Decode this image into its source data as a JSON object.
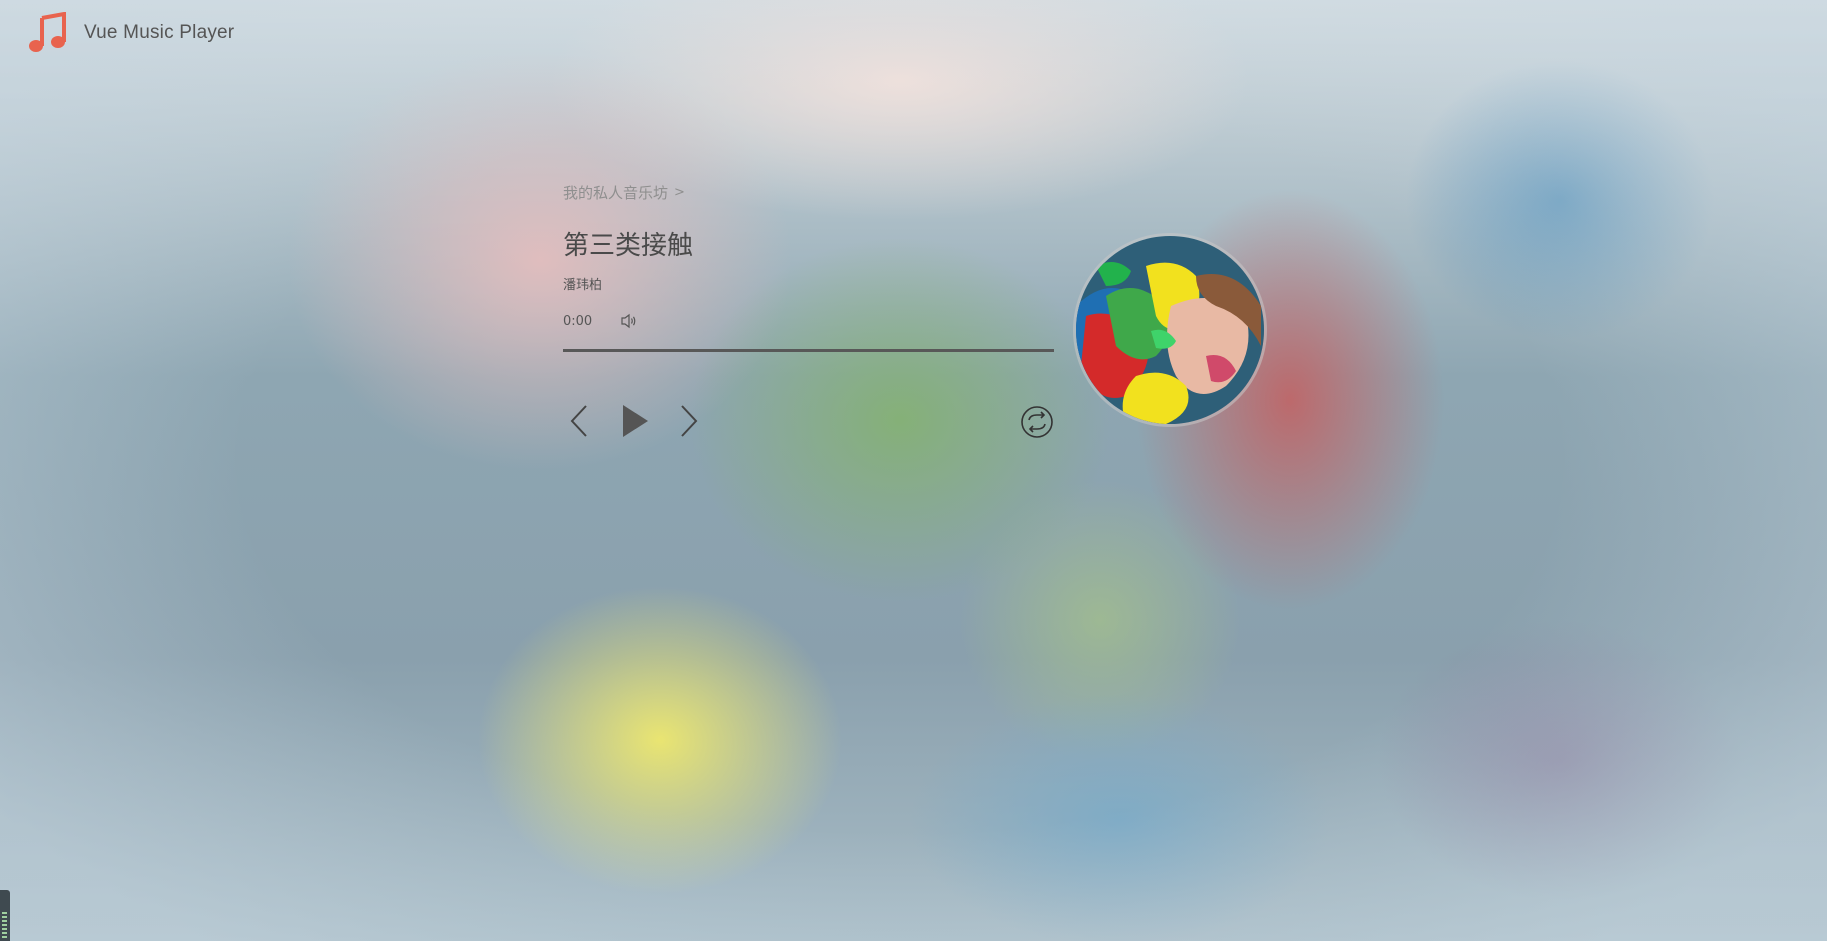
{
  "app": {
    "title": "Vue Music Player",
    "logo_icon": "music-note-icon",
    "logo_color": "#e8634e"
  },
  "player": {
    "breadcrumb": "我的私人音乐坊",
    "breadcrumb_arrow": ">",
    "song_title": "第三类接触",
    "artist": "潘玮柏",
    "current_time": "0:00",
    "progress": 0,
    "controls": {
      "prev_icon": "chevron-left-icon",
      "play_icon": "play-icon",
      "next_icon": "chevron-right-icon",
      "loop_icon": "loop-icon",
      "volume_icon": "volume-icon"
    },
    "album_art": "album-cover-art"
  }
}
